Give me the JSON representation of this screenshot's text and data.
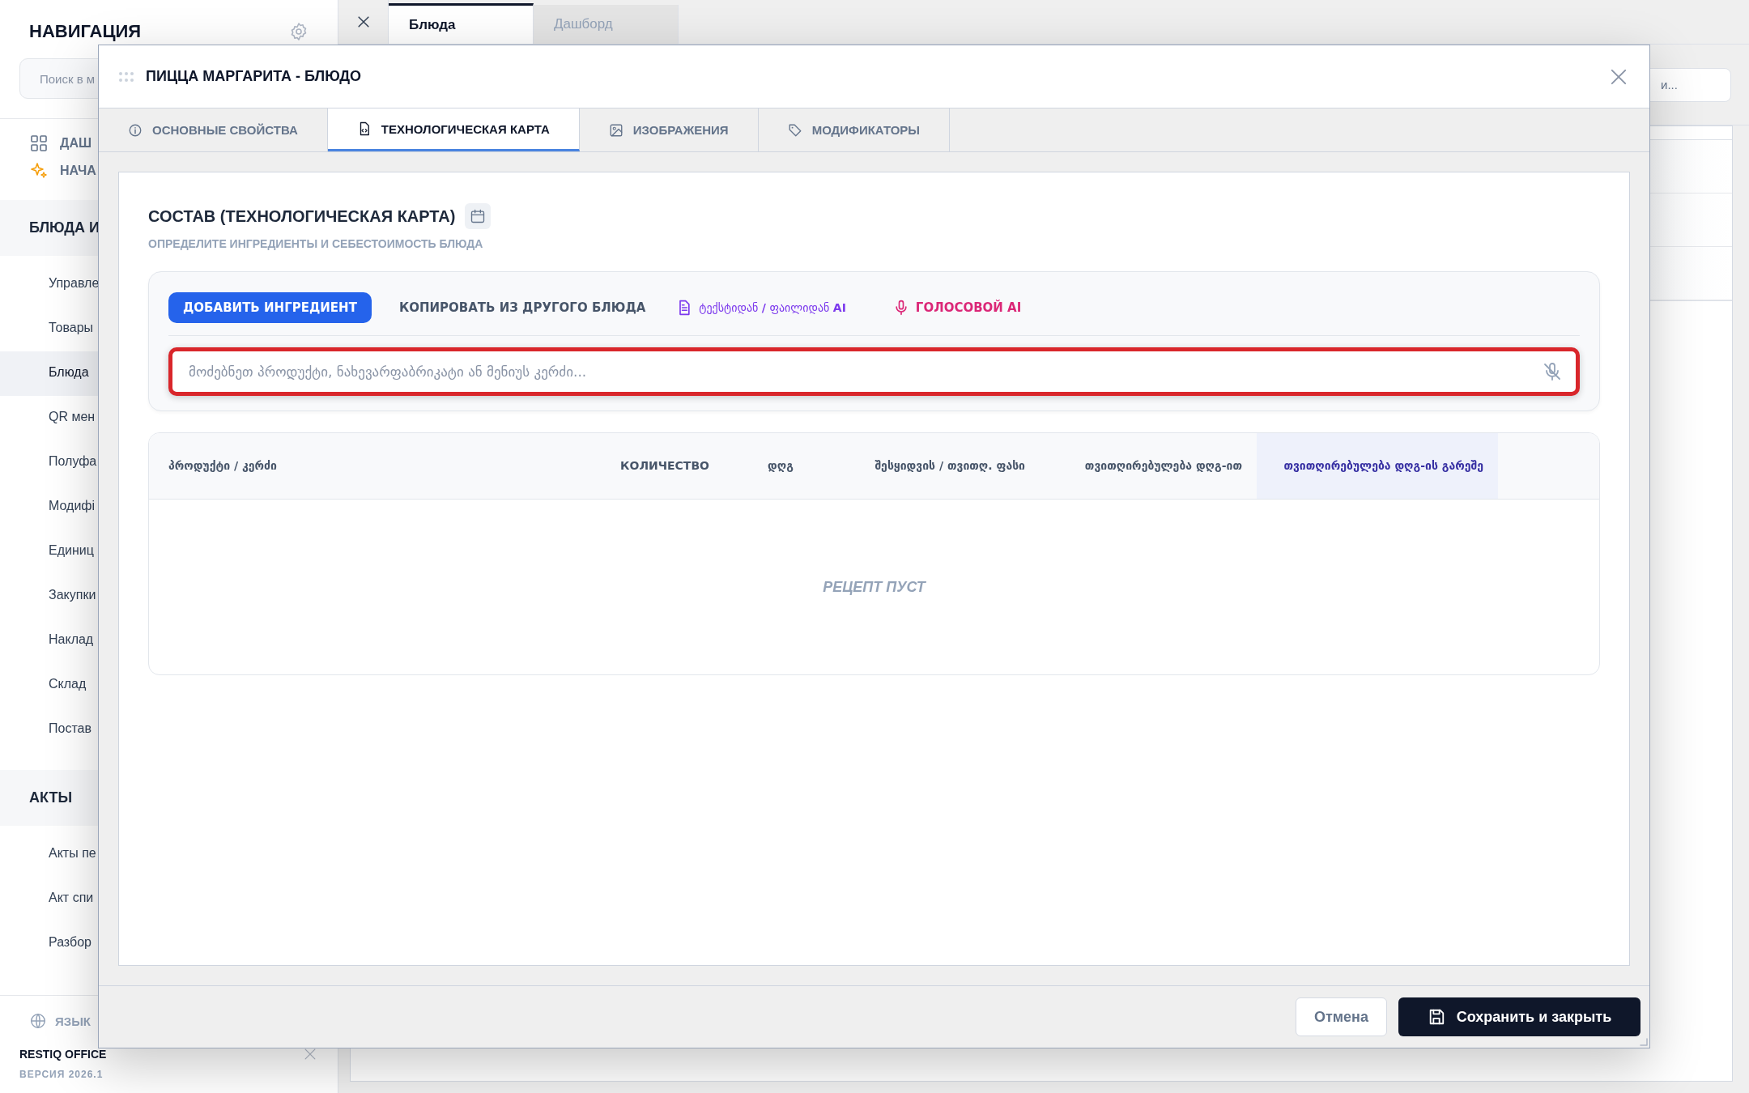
{
  "sidebar": {
    "title": "НАВИГАЦИЯ",
    "search": {
      "placeholder": "Поиск в м"
    },
    "quick_links": [
      {
        "kind": "grid",
        "label": "ДАШ"
      },
      {
        "kind": "sparkle",
        "label": "НАЧА"
      }
    ],
    "sections": [
      {
        "title": "БЛЮДА И",
        "items": [
          {
            "label": "Управле",
            "selected": false
          },
          {
            "label": "Товары",
            "selected": false
          },
          {
            "label": "Блюда",
            "selected": true
          },
          {
            "label": "QR мен",
            "selected": false
          },
          {
            "label": "Полуфа",
            "selected": false
          },
          {
            "label": "Модифі",
            "selected": false
          },
          {
            "label": "Единиц",
            "selected": false
          },
          {
            "label": "Закупки",
            "selected": false
          },
          {
            "label": "Наклад",
            "selected": false
          },
          {
            "label": "Склад",
            "selected": false
          },
          {
            "label": "Постав",
            "selected": false
          }
        ]
      },
      {
        "title": "АКТЫ",
        "items": [
          {
            "label": "Акты пе",
            "selected": false
          },
          {
            "label": "Акт спи",
            "selected": false
          },
          {
            "label": "Разбор",
            "selected": false
          }
        ]
      }
    ],
    "language": "ЯЗЫК",
    "brand": "RESTIQ OFFICE",
    "version": "ВЕРСИЯ 2026.1"
  },
  "tabs": [
    {
      "label": "Блюда",
      "selected": true
    },
    {
      "label": "Дашборд",
      "selected": false
    }
  ],
  "header_search": {
    "placeholder": "и..."
  },
  "modal": {
    "title": "ПИЦЦА МАРГАРИТА - БЛЮДО",
    "tabs": [
      {
        "kind": "info",
        "label": "ОСНОВНЫЕ СВОЙСТВА",
        "selected": false
      },
      {
        "kind": "file",
        "label": "ТЕХНОЛОГИЧЕСКАЯ КАРТА",
        "selected": true
      },
      {
        "kind": "image",
        "label": "ИЗОБРАЖЕНИЯ",
        "selected": false
      },
      {
        "kind": "tag",
        "label": "МОДИФИКАТОРЫ",
        "selected": false
      }
    ],
    "section": {
      "title": "СОСТАВ (ТЕХНОЛОГИЧЕСКАЯ КАРТА)",
      "subtitle": "ОПРЕДЕЛИТЕ ИНГРЕДИЕНТЫ И СЕБЕСТОИМОСТЬ БЛЮДА"
    },
    "actions": [
      {
        "kind": "primary",
        "label": "ДОБАВИТЬ ИНГРЕДИЕНТ"
      },
      {
        "kind": "plain",
        "label": "КОПИРОВАТЬ ИЗ ДРУГОГО БЛЮДА"
      },
      {
        "kind": "text-ai",
        "label": "ტექსტიდან **/** ფაილიდან **AI**"
      },
      {
        "kind": "voice-ai",
        "label": "ГОЛОСОВОЙ AI"
      }
    ],
    "search": {
      "placeholder": "მოძებნეთ პროდუქტი, ნახევარფაბრიკატი ან მენიუს კერძი...",
      "highlighted": true
    },
    "table": {
      "columns": [
        {
          "label": "პროდუქტი / კერძი",
          "highlighted": false
        },
        {
          "label": "КОЛИЧЕСТВО",
          "highlighted": false
        },
        {
          "label": "დღგ",
          "highlighted": false
        },
        {
          "label": "შესყიდვის / თვითღ. ფასი",
          "highlighted": false
        },
        {
          "label": "თვითღირებულება დღგ-ით",
          "highlighted": false
        },
        {
          "label": "თვითღირებულება დღგ-ის გარეშე",
          "highlighted": true
        }
      ],
      "empty_text": "РЕЦЕПТ ПУСТ"
    },
    "buttons": [
      {
        "kind": "secondary",
        "label": "Отмена"
      },
      {
        "kind": "primary",
        "label": "Сохранить и закрыть"
      }
    ]
  }
}
